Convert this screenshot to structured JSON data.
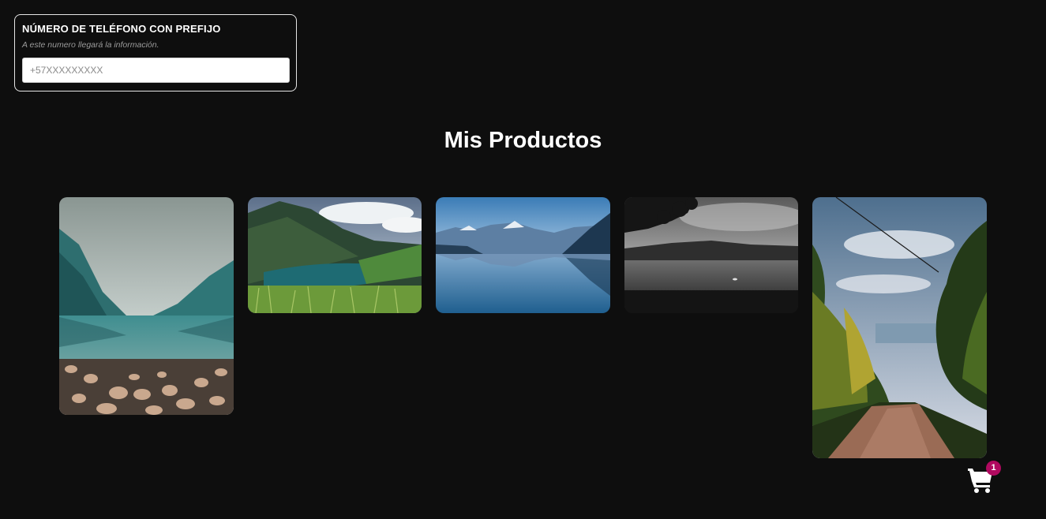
{
  "phone_form": {
    "title": "NÚMERO DE TELÉFONO CON PREFIJO",
    "help_text": "A este numero llegará la información.",
    "placeholder": "+57XXXXXXXXX",
    "value": ""
  },
  "products_section": {
    "title": "Mis Productos"
  },
  "products": [
    {
      "image": "mountain-lake-with-rocks"
    },
    {
      "image": "green-valley-lake"
    },
    {
      "image": "blue-mountain-lake-reflection"
    },
    {
      "image": "black-and-white-lake"
    },
    {
      "image": "forest-dirt-road"
    }
  ],
  "cart": {
    "icon": "shopping-cart-icon",
    "count": "1",
    "badge_color": "#b0095f"
  },
  "colors": {
    "background": "#0e0e0e",
    "text": "#ffffff"
  }
}
